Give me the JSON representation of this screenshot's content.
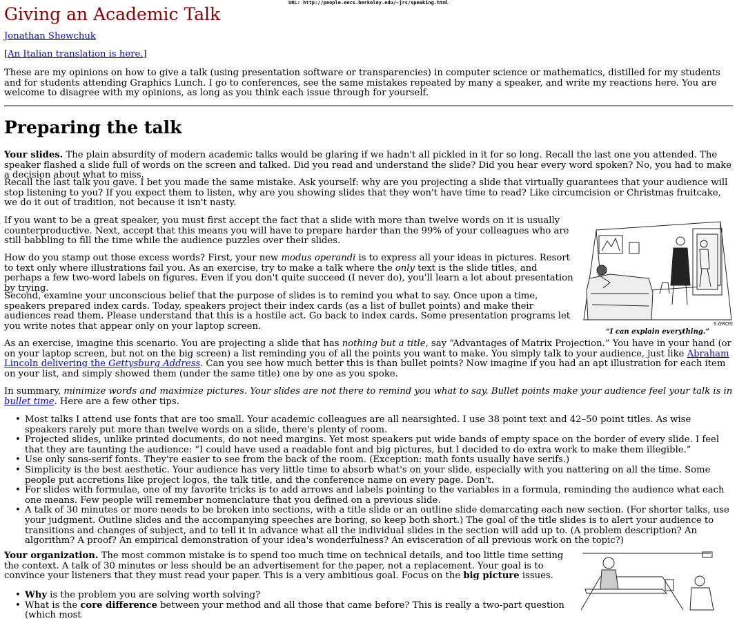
{
  "url_bar": "URL: http://people.eecs.berkeley.edu/~jrs/speaking.html",
  "colors": {
    "title": "#8b0000",
    "link": "#0000ee",
    "rule": "#8a8a8a"
  },
  "header": {
    "title": "Giving an Academic Talk",
    "author_link": "Jonathan Shewchuk",
    "translation_link": "An Italian translation is here."
  },
  "intro": "These are my opinions on how to give a talk (using presentation software or transparencies) in computer science or mathematics, distilled for my students and for students attending Graphics Lunch. I go to conferences, see the same mistakes repeated by many a speaker, and write my reactions here. You are welcome to disagree with my opinions, as long as you think each issue through for yourself.",
  "section": {
    "heading": "Preparing the talk",
    "slides_lead": "Your slides.",
    "slides_p1": "The plain absurdity of modern academic talks would be glaring if we hadn't all pickled in it for so long. Recall the last one you attended. The speaker flashed a slide full of words on the screen and talked. Did you read and understand the slide? Did you hear every word spoken? No, you had to make a decision about what to miss.",
    "slides_p2": "Recall the last talk you gave. I bet you made the same mistake. Ask yourself: why are you projecting a slide that virtually guarantees that your audience will stop listening to you? If you expect them to listen, why are you showing slides that they won't have time to read? Like circumcision or Christmas fruitcake, we do it out of tradition, not because it isn't nasty.",
    "slides_p3": "If you want to be a great speaker, you must first accept the fact that a slide with more than twelve words on it is usually counterproductive. Next, accept that this means you will have to prepare harder than the 99% of your colleagues who are still babbling to fill the time while the audience puzzles over their slides.",
    "p4_a": "How do you stamp out those excess words? First, your new ",
    "p4_em1": "modus operandi",
    "p4_b": " is to express all your ideas in pictures. Resort to text only where illustrations fail you. As an exercise, try to make a talk where the ",
    "p4_em2": "only",
    "p4_c": " text is the slide titles, and perhaps a few two-word labels on figures. Even if you don't quite succeed (I never do), you'll learn a lot about presentation by trying.",
    "p5": "Second, examine your unconscious belief that the purpose of slides is to remind you what to say. Once upon a time, speakers prepared index cards. Today, speakers project their index cards (as a list of bullet points) and make their audiences read them. Please understand that this is a hostile act. Go back to index cards. Some presentation programs let you write notes that appear only on your laptop screen.",
    "p6_a": "As an exercise, imagine this scenario. You are projecting a slide that has ",
    "p6_em": "nothing but a title",
    "p6_b": ", say “Advantages of Matrix Projection.” You have in your hand (or on your laptop screen, but not on the big screen) a list reminding you of all the points you want to make. You simply talk to your audience, just like ",
    "p6_link_a": "Abraham Lincoln delivering the ",
    "p6_link_em": "Gettysburg Address",
    "p6_c": ". Can you see how much better this is than bullet points? Now imagine if you had an apt illustration for each item on your list, and simply showed them (under the same title) one by one as you spoke.",
    "p7_a": "In summary, ",
    "p7_em": "minimize words and maximize pictures. Your slides are not there to remind you what to say. Bullet points make your audience feel your talk is in ",
    "p7_link": "bullet time",
    "p7_b": ". Here are a few other tips.",
    "tips": [
      "Most talks I attend use fonts that are too small. Your academic colleagues are all nearsighted. I use 38 point text and 42–50 point titles. As wise speakers rarely put more than twelve words on a slide, there's plenty of room.",
      "Projected slides, unlike printed documents, do not need margins. Yet most speakers put wide bands of empty space on the border of every slide. I feel that they are taunting the audience: “I could have used a readable font and big pictures, but I decided to do extra work to make them illegible.”",
      "Use only sans-serif fonts. They're easier to see from the back of the room. (Exception: math fonts usually have serifs.)",
      "Simplicity is the best aesthetic. Your audience has very little time to absorb what's on your slide, especially with you nattering on all the time. Some people put accretions like project logos, the talk title, and the conference name on every page. Don't.",
      "For slides with formulae, one of my favorite tricks is to add arrows and labels pointing to the variables in a formula, reminding the audience what each one means. Few people will remember nomenclature that you defined on a previous slide.",
      "A talk of 30 minutes or more needs to be broken into sections, with a title slide or an outline slide demarcating each new section. (For shorter talks, use your judgment. Outline slides and the accompanying speeches are boring, so keep both short.) The goal of the title slides is to alert your audience to transitions and changes of subject, and to tell it in advance what all the individual slides in the section will add up to. (A problem description? An algorithm? A proof? An empirical demonstration of your idea's wonderfulness? An evisceration of all previous work on the topic?)"
    ],
    "org_lead": "Your organization.",
    "org_text_a": " The most common mistake is to spend too much time on technical details, and too little time setting the context. A talk of 30 minutes or less should be an advertisement for the paper, not a replacement. Your goal is to convince your listeners that they must read your paper. This is a very ambitious goal. Focus on the ",
    "org_bold": "big picture",
    "org_text_b": " issues.",
    "org_b1_bold": "Why",
    "org_b1_rest": " is the problem you are solving worth solving?",
    "org_b2_a": "What is the ",
    "org_b2_bold": "core difference",
    "org_b2_b": " between your method and all those that came before? This is really a two-part question (which most",
    "cartoon_caption": "“I can explain everything.”",
    "cartoon_signature": "S.GROSS"
  }
}
